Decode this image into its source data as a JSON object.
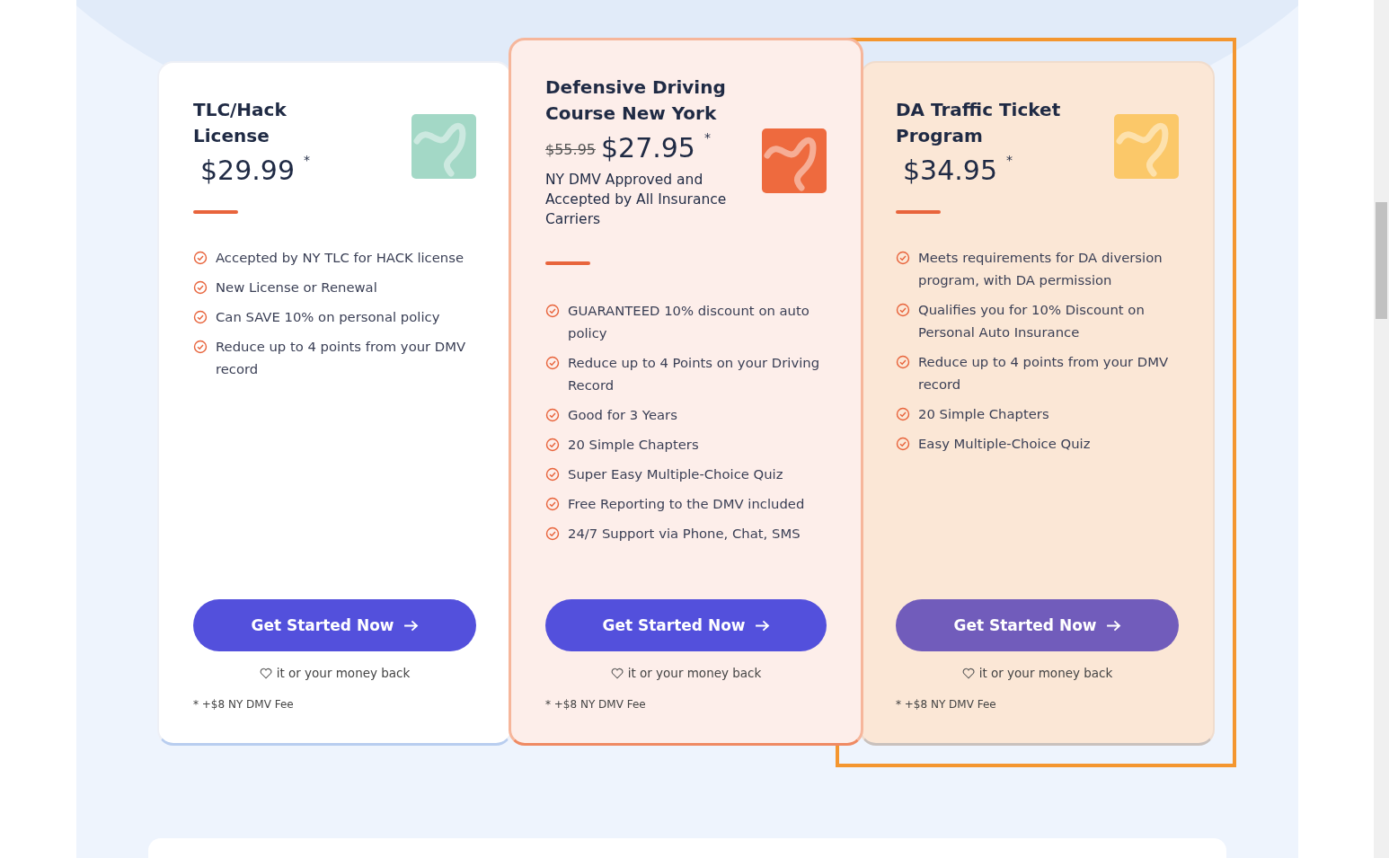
{
  "plans": [
    {
      "kind": "standard",
      "highlighted": false,
      "title": "TLC/Hack License",
      "price": "$29.99",
      "price_mark": "*",
      "color": "#a3d8c6",
      "features": [
        "Accepted by NY TLC for HACK license",
        "New License or Renewal",
        "Can SAVE 10% on personal policy",
        "Reduce up to 4 points from your DMV record"
      ],
      "button": "Get Started Now",
      "guarantee": "it or your money back",
      "fee_note": "* +$8 NY DMV Fee"
    },
    {
      "kind": "featured",
      "highlighted": false,
      "title": "Defensive Driving Course New York",
      "old_price": "$55.95",
      "price": "$27.95",
      "price_mark": "*",
      "subtitle": "NY DMV Approved and Accepted by All Insurance Carriers",
      "color": "#ee6a3e",
      "features": [
        "GUARANTEED 10% discount on auto policy",
        "Reduce up to 4 Points on your Driving Record",
        "Good for 3 Years",
        "20 Simple Chapters",
        "Super Easy Multiple-Choice Quiz",
        "Free Reporting to the DMV included",
        "24/7 Support via Phone, Chat, SMS"
      ],
      "button": "Get Started Now",
      "guarantee": "it or your money back",
      "fee_note": "* +$8 NY DMV Fee"
    },
    {
      "kind": "standard",
      "highlighted": true,
      "title": "DA Traffic Ticket Program",
      "price": "$34.95",
      "price_mark": "*",
      "color": "#fbc869",
      "features": [
        "Meets requirements for DA diversion program, with DA permission",
        "Qualifies you for 10% Discount on Personal Auto Insurance",
        "Reduce up to 4 points from your DMV record",
        "20 Simple Chapters",
        "Easy Multiple-Choice Quiz"
      ],
      "button": "Get Started Now",
      "guarantee": "it or your money back",
      "fee_note": "* +$8 NY DMV Fee"
    }
  ]
}
